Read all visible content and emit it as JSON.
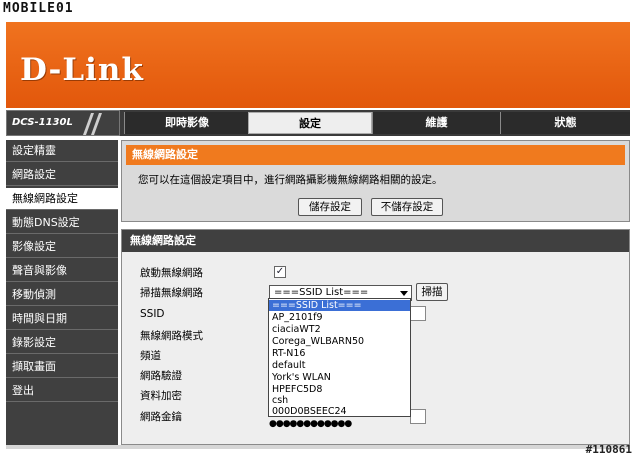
{
  "watermark": {
    "brand": "MOBILE01",
    "sub": "MOBILE01"
  },
  "header": {
    "logo": "D-Link",
    "model": "DCS-1130L"
  },
  "tabs": [
    {
      "label": "即時影像",
      "active": false
    },
    {
      "label": "設定",
      "active": true
    },
    {
      "label": "維護",
      "active": false
    },
    {
      "label": "狀態",
      "active": false
    }
  ],
  "sidebar": {
    "items": [
      {
        "label": "設定精靈",
        "active": false
      },
      {
        "label": "網路設定",
        "active": false
      },
      {
        "label": "無線網路設定",
        "active": true
      },
      {
        "label": "動態DNS設定",
        "active": false
      },
      {
        "label": "影像設定",
        "active": false
      },
      {
        "label": "聲音與影像",
        "active": false
      },
      {
        "label": "移動偵測",
        "active": false
      },
      {
        "label": "時間與日期",
        "active": false
      },
      {
        "label": "錄影設定",
        "active": false
      },
      {
        "label": "擷取畫面",
        "active": false
      },
      {
        "label": "登出",
        "active": false
      }
    ]
  },
  "settings_box": {
    "title": "無線網路設定",
    "description": "您可以在這個設定項目中，進行網路攝影機無線網路相關的設定。",
    "save_label": "儲存設定",
    "nosave_label": "不儲存設定"
  },
  "wireless_box": {
    "title": "無線網路設定",
    "fields": {
      "enable_label": "啟動無線網路",
      "enable_checked": "✓",
      "scan_label": "掃描無線網路",
      "ssid_label": "SSID",
      "mode_label": "無線網路模式",
      "channel_label": "頻道",
      "auth_label": "網路驗證",
      "encrypt_label": "資料加密",
      "key_label": "網路金鑰"
    },
    "ssid_selected": "===SSID List===",
    "scan_button": "掃描",
    "key_masked": "●●●●●●●●●●●●"
  },
  "dropdown_options": [
    "===SSID List===",
    "AP_2101f9",
    "ciaciaWT2",
    "Corega_WLBARN50",
    "RT-N16",
    "default",
    "York's WLAN",
    "HPEFC5D8",
    "csh",
    "000D0BSEEC24"
  ],
  "photo_id": "#110861",
  "colors": {
    "orange": "#f07a1e",
    "dark": "#404040",
    "selected": "#3b6fd6"
  }
}
